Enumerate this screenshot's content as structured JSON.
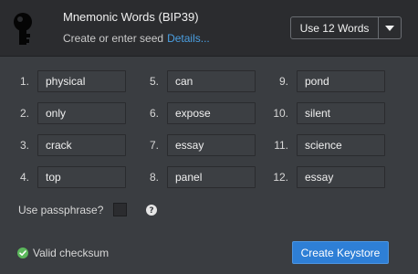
{
  "header": {
    "title": "Mnemonic Words (BIP39)",
    "subtitle": "Create or enter seed",
    "details_link": "Details...",
    "word_count": "Use 12 Words",
    "icons": {
      "key": "key-icon",
      "dropdown": "chevron-down-icon"
    }
  },
  "words": [
    {
      "num": "1.",
      "word": "physical"
    },
    {
      "num": "2.",
      "word": "only"
    },
    {
      "num": "3.",
      "word": "crack"
    },
    {
      "num": "4.",
      "word": "top"
    },
    {
      "num": "5.",
      "word": "can"
    },
    {
      "num": "6.",
      "word": "expose"
    },
    {
      "num": "7.",
      "word": "essay"
    },
    {
      "num": "8.",
      "word": "panel"
    },
    {
      "num": "9.",
      "word": "pond"
    },
    {
      "num": "10.",
      "word": "silent"
    },
    {
      "num": "11.",
      "word": "science"
    },
    {
      "num": "12.",
      "word": "essay"
    }
  ],
  "passphrase": {
    "label": "Use passphrase?",
    "checked": false,
    "help_icon": "question-icon"
  },
  "checksum": {
    "text": "Valid checksum",
    "icon": "check-circle-icon",
    "color": "#5cb85c"
  },
  "actions": {
    "create_label": "Create Keystore"
  },
  "colors": {
    "accent": "#2e7fd6",
    "link": "#4a9fe2"
  }
}
